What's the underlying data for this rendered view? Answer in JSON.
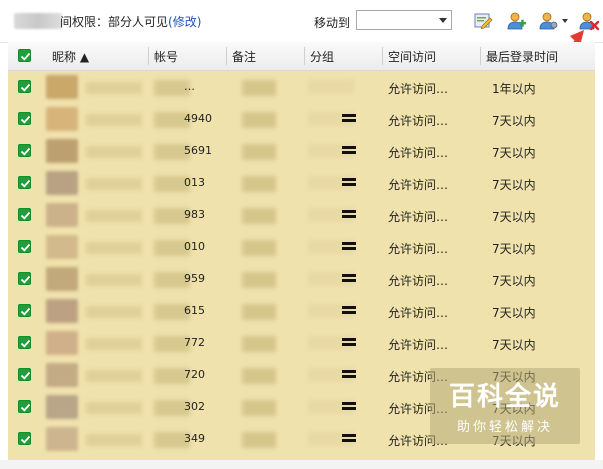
{
  "toolbar": {
    "permission_label": "间权限：部分人可见",
    "modify_link": "(修改)",
    "move_to_label": "移动到",
    "move_to_value": ""
  },
  "table": {
    "columns": [
      "昵称 ▲",
      "帐号",
      "备注",
      "分组",
      "空间访问",
      "最后登录时间"
    ],
    "rows": [
      {
        "account": "…",
        "space": "允许访问…",
        "last_login": "1年以内"
      },
      {
        "account": "4940",
        "space": "允许访问…",
        "last_login": "7天以内"
      },
      {
        "account": "5691",
        "space": "允许访问…",
        "last_login": "7天以内"
      },
      {
        "account": "013",
        "space": "允许访问…",
        "last_login": "7天以内"
      },
      {
        "account": "983",
        "space": "允许访问…",
        "last_login": "7天以内"
      },
      {
        "account": "010",
        "space": "允许访问…",
        "last_login": "7天以内"
      },
      {
        "account": "959",
        "space": "允许访问…",
        "last_login": "7天以内"
      },
      {
        "account": "615",
        "space": "允许访问…",
        "last_login": "7天以内"
      },
      {
        "account": "772",
        "space": "允许访问…",
        "last_login": "7天以内"
      },
      {
        "account": "720",
        "space": "允许访问…",
        "last_login": "7天以内"
      },
      {
        "account": "302",
        "space": "允许访问…",
        "last_login": "7天以内"
      },
      {
        "account": "349",
        "space": "允许访问…",
        "last_login": "7天以内"
      }
    ]
  },
  "watermark": {
    "title": "百科全说",
    "subtitle": "助你轻松解决"
  },
  "colors": {
    "row_bg": "#f0e2ad",
    "checkbox": "#1f9e3a",
    "link": "#1a55b8",
    "annotation_arrow": "#e53935"
  }
}
